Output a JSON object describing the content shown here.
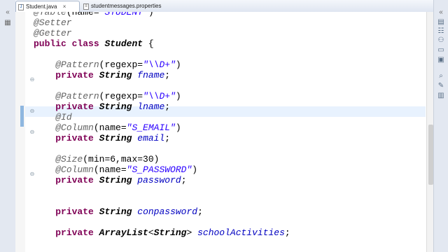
{
  "tabs": [
    {
      "label": "Student.java",
      "active": true,
      "close": "×"
    },
    {
      "label": "studentmessages.properties",
      "active": false
    }
  ],
  "code_lines": [
    [
      [
        "ann",
        "@Table"
      ],
      [
        "plain",
        "("
      ],
      [
        "plain",
        "name="
      ],
      [
        "str",
        "\"STUDENT\""
      ],
      [
        "plain",
        ")"
      ]
    ],
    [
      [
        "ann",
        "@Setter"
      ]
    ],
    [
      [
        "ann",
        "@Getter"
      ]
    ],
    [
      [
        "kw",
        "public"
      ],
      [
        "plain",
        " "
      ],
      [
        "kw",
        "class"
      ],
      [
        "plain",
        " "
      ],
      [
        "typ",
        "Student"
      ],
      [
        "plain",
        " {"
      ]
    ],
    [],
    [
      [
        "plain",
        "    "
      ],
      [
        "ann",
        "@Pattern"
      ],
      [
        "plain",
        "(regexp="
      ],
      [
        "str",
        "\"\\\\D+\""
      ],
      [
        "plain",
        ")"
      ]
    ],
    [
      [
        "plain",
        "    "
      ],
      [
        "kw",
        "private"
      ],
      [
        "plain",
        " "
      ],
      [
        "typ",
        "String"
      ],
      [
        "plain",
        " "
      ],
      [
        "fld",
        "fname"
      ],
      [
        "plain",
        ";"
      ]
    ],
    [],
    [
      [
        "plain",
        "    "
      ],
      [
        "ann",
        "@Pattern"
      ],
      [
        "plain",
        "(regexp="
      ],
      [
        "str",
        "\"\\\\D+\""
      ],
      [
        "plain",
        ")"
      ]
    ],
    [
      [
        "plain",
        "    "
      ],
      [
        "kw",
        "private"
      ],
      [
        "plain",
        " "
      ],
      [
        "typ",
        "String"
      ],
      [
        "plain",
        " "
      ],
      [
        "fld",
        "lname"
      ],
      [
        "plain",
        ";"
      ]
    ],
    [
      [
        "plain",
        "    "
      ],
      [
        "ann",
        "@Id"
      ]
    ],
    [
      [
        "plain",
        "    "
      ],
      [
        "ann",
        "@Column"
      ],
      [
        "plain",
        "(name="
      ],
      [
        "str",
        "\"S_EMAIL\""
      ],
      [
        "plain",
        ")"
      ]
    ],
    [
      [
        "plain",
        "    "
      ],
      [
        "kw",
        "private"
      ],
      [
        "plain",
        " "
      ],
      [
        "typ",
        "String"
      ],
      [
        "plain",
        " "
      ],
      [
        "fld",
        "email"
      ],
      [
        "plain",
        ";"
      ]
    ],
    [],
    [
      [
        "plain",
        "    "
      ],
      [
        "ann",
        "@Size"
      ],
      [
        "plain",
        "(min=6,max=30)"
      ]
    ],
    [
      [
        "plain",
        "    "
      ],
      [
        "ann",
        "@Column"
      ],
      [
        "plain",
        "(name="
      ],
      [
        "str",
        "\"S_PASSWORD\""
      ],
      [
        "plain",
        ")"
      ]
    ],
    [
      [
        "plain",
        "    "
      ],
      [
        "kw",
        "private"
      ],
      [
        "plain",
        " "
      ],
      [
        "typ",
        "String"
      ],
      [
        "plain",
        " "
      ],
      [
        "fld",
        "password"
      ],
      [
        "plain",
        ";"
      ]
    ],
    [],
    [],
    [
      [
        "plain",
        "    "
      ],
      [
        "kw",
        "private"
      ],
      [
        "plain",
        " "
      ],
      [
        "typ",
        "String"
      ],
      [
        "plain",
        " "
      ],
      [
        "fld",
        "conpassword"
      ],
      [
        "plain",
        ";"
      ]
    ],
    [],
    [
      [
        "plain",
        "    "
      ],
      [
        "kw",
        "private"
      ],
      [
        "plain",
        " "
      ],
      [
        "typ",
        "ArrayList"
      ],
      [
        "plain",
        "<"
      ],
      [
        "typ",
        "String"
      ],
      [
        "plain",
        "> "
      ],
      [
        "fld",
        "schoolActivities"
      ],
      [
        "plain",
        ";"
      ]
    ],
    []
  ],
  "colors": {
    "keyword": "#7f0055",
    "annotation": "#646464",
    "string": "#2a00ff",
    "field": "#0000c0",
    "current_line": "#e8f2fe"
  },
  "icons": {
    "left": [
      "collapse-icon",
      "package-icon"
    ],
    "right": [
      "collapse-icon",
      "task-icon",
      "outline-icon",
      "hierarchy-icon",
      "console-icon",
      "problems-icon",
      "search-icon",
      "bookmarks-icon",
      "servers-icon",
      "properties-icon"
    ]
  }
}
